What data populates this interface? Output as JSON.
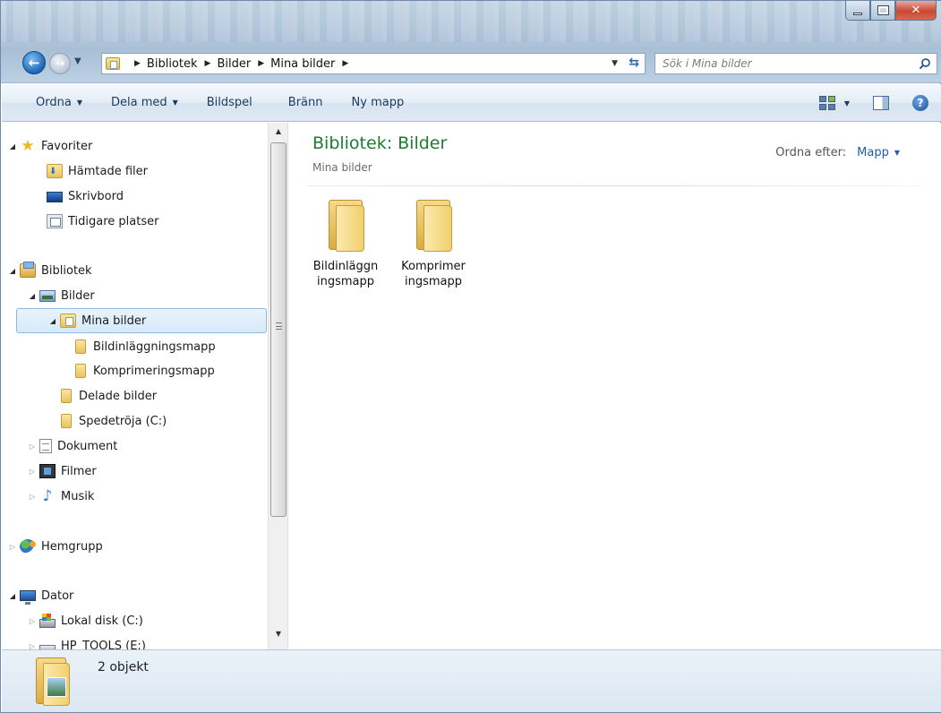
{
  "address": {
    "crumbs": [
      "Bibliotek",
      "Bilder",
      "Mina bilder"
    ]
  },
  "search": {
    "placeholder": "Sök i Mina bilder"
  },
  "toolbar": {
    "organize": "Ordna",
    "share": "Dela med",
    "slideshow": "Bildspel",
    "burn": "Bränn",
    "new_folder": "Ny mapp"
  },
  "nav": {
    "favorites": "Favoriter",
    "downloads": "Hämtade filer",
    "desktop": "Skrivbord",
    "recent": "Tidigare platser",
    "libraries": "Bibliotek",
    "pictures": "Bilder",
    "my_pictures": "Mina bilder",
    "import_folder": "Bildinläggningsmapp",
    "compress_folder": "Komprimeringsmapp",
    "shared_pictures": "Delade bilder",
    "spede_drive": "Spedetröja (C:)",
    "documents": "Dokument",
    "videos": "Filmer",
    "music": "Musik",
    "homegroup": "Hemgrupp",
    "computer": "Dator",
    "local_disk": "Lokal disk (C:)",
    "hp_tools": "HP_TOOLS (E:)"
  },
  "content": {
    "title": "Bibliotek: Bilder",
    "subtitle": "Mina bilder",
    "arrange_label": "Ordna efter:",
    "arrange_value": "Mapp",
    "items": [
      {
        "label_line1": "Bildinläggn",
        "label_line2": "ingsmapp"
      },
      {
        "label_line1": "Komprimer",
        "label_line2": "ingsmapp"
      }
    ]
  },
  "details": {
    "count": "2 objekt"
  },
  "colors": {
    "title_green": "#1e7b32",
    "link_blue": "#1f5fa8",
    "selection_border": "#8fb9e3"
  }
}
